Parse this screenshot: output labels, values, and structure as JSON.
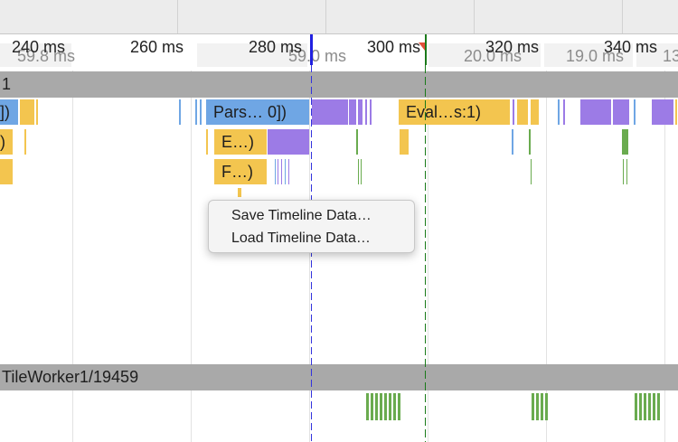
{
  "ruler": {
    "ticks": [
      "240 ms",
      "260 ms",
      "280 ms",
      "300 ms",
      "320 ms",
      "340 ms"
    ],
    "frame_durations": [
      "59.8 ms",
      "59.0 ms",
      "20.0 ms",
      "19.0 ms",
      "13"
    ]
  },
  "tracks": {
    "main_thread_header": "1",
    "raster_thread_header": "TileWorker1/19459"
  },
  "flame": {
    "row1_left": "])",
    "parse_html": "Pars… 0])",
    "evaluate_script": "Eval…s:1)",
    "row2_left": ")",
    "row2_event": "E…)",
    "row3_event": "F…)"
  },
  "context_menu": {
    "items": [
      "Save Timeline Data…",
      "Load Timeline Data…"
    ]
  },
  "colors": {
    "scripting": "#f3c54f",
    "loading": "#6fa6e4",
    "rendering": "#9c7be6",
    "painting": "#6aab4f",
    "section_header": "#a9a9a9"
  }
}
